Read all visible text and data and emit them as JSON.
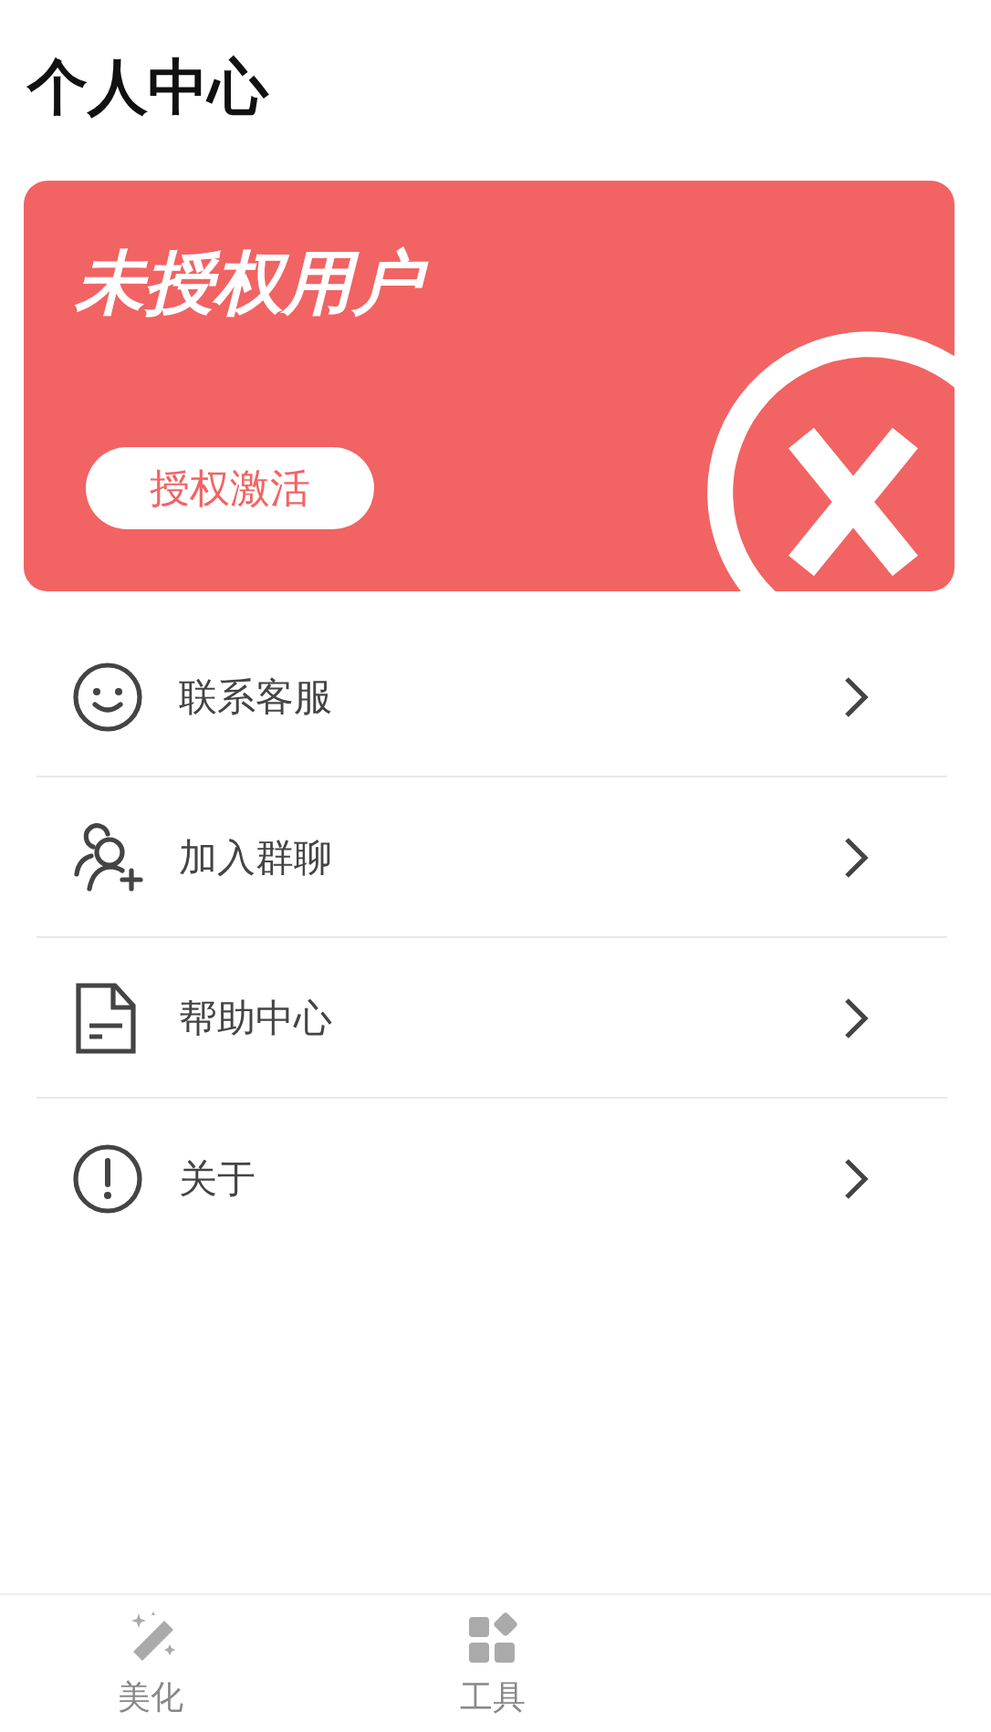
{
  "page_title": "个人中心",
  "license_card": {
    "status": "未授权用户",
    "button": "授权激活"
  },
  "menu": [
    {
      "label": "联系客服",
      "kind": "smile"
    },
    {
      "label": "加入群聊",
      "kind": "group"
    },
    {
      "label": "帮助中心",
      "kind": "doc"
    },
    {
      "label": "关于",
      "kind": "info"
    }
  ],
  "tab_bar": [
    {
      "label": "美化",
      "kind": "wand",
      "selected": false
    },
    {
      "label": "工具",
      "kind": "grid",
      "selected": false
    }
  ]
}
